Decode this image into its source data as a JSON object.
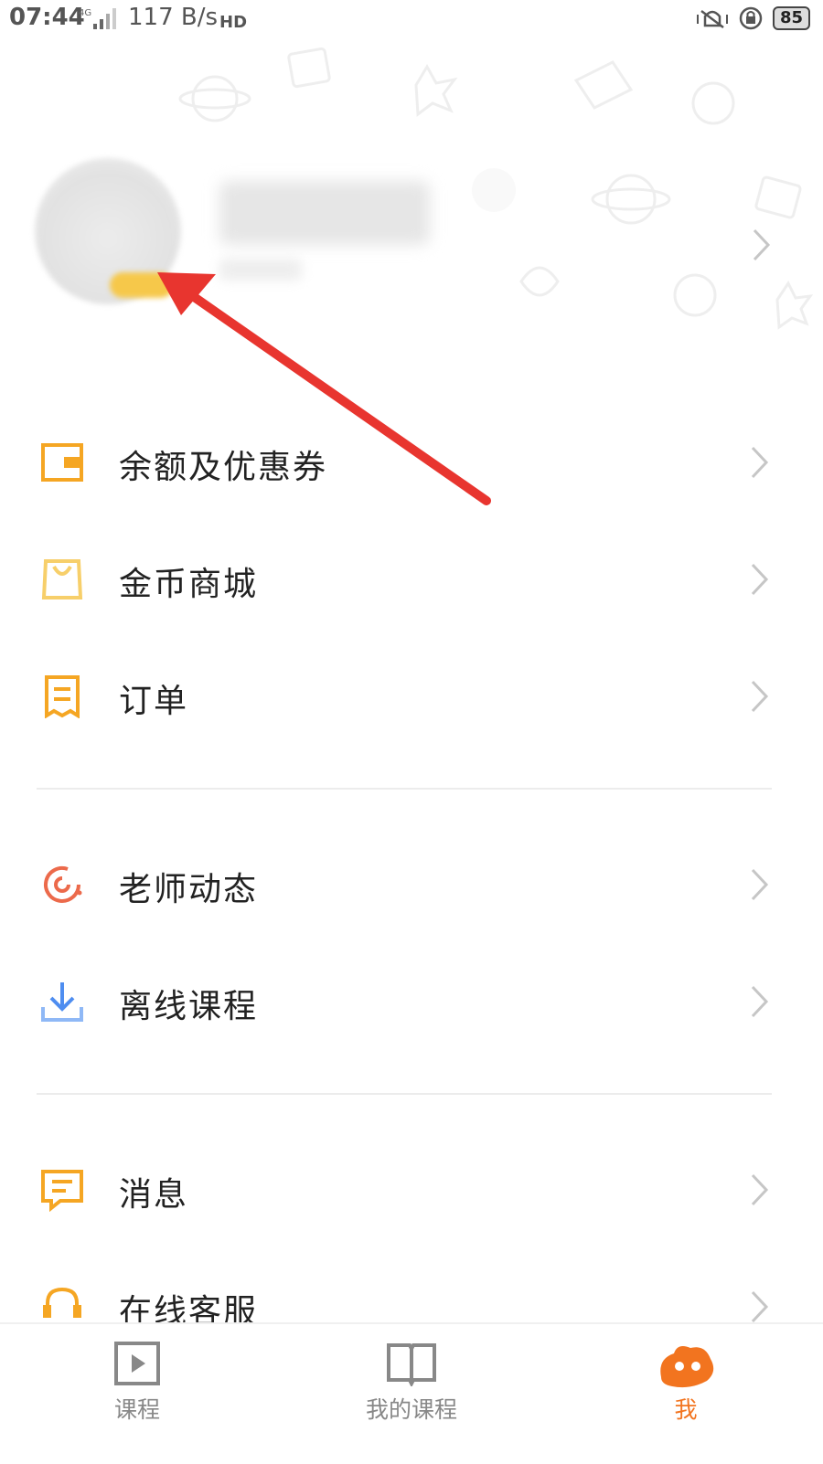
{
  "status_bar": {
    "time": "07:44",
    "network_speed": "117 B/s",
    "battery": "85"
  },
  "profile": {
    "chevron_icon": "chevron-right-icon"
  },
  "menu": {
    "groups": [
      [
        {
          "label": "余额及优惠券",
          "icon": "wallet-icon",
          "color": "#f5a623"
        },
        {
          "label": "金币商城",
          "icon": "shopping-bag-icon",
          "color": "#f7cf6a"
        },
        {
          "label": "订单",
          "icon": "receipt-icon",
          "color": "#f5a623"
        }
      ],
      [
        {
          "label": "老师动态",
          "icon": "teacher-activity-icon",
          "color": "#ec6a4b"
        },
        {
          "label": "离线课程",
          "icon": "download-icon",
          "color": "#4e8df0"
        }
      ],
      [
        {
          "label": "消息",
          "icon": "message-icon",
          "color": "#f5a623"
        },
        {
          "label": "在线客服",
          "icon": "headset-icon",
          "color": "#f5a623"
        }
      ]
    ]
  },
  "bottom_nav": {
    "tabs": [
      {
        "label": "课程",
        "icon": "play-icon",
        "active": false
      },
      {
        "label": "我的课程",
        "icon": "book-icon",
        "active": false
      },
      {
        "label": "我",
        "icon": "profile-mascot-icon",
        "active": true
      }
    ],
    "accent_color": "#f2741f"
  }
}
